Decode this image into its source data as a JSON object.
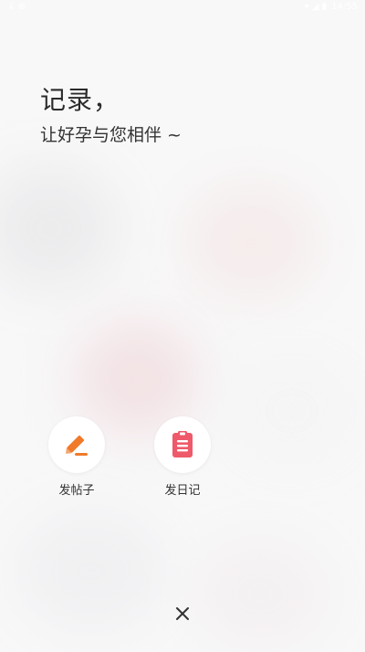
{
  "status_bar": {
    "left_icons": "↓ ⊕",
    "right_icons": "▾ ◢ ▮",
    "time": "14:55"
  },
  "headline": {
    "title": "记录，",
    "subtitle": "让好孕与您相伴 ~"
  },
  "actions": [
    {
      "label": "发帖子",
      "icon": "pencil-icon",
      "color": "#f07a2a"
    },
    {
      "label": "发日记",
      "icon": "notebook-icon",
      "color": "#ee5a6a"
    }
  ],
  "close": {
    "icon": "close-icon"
  }
}
